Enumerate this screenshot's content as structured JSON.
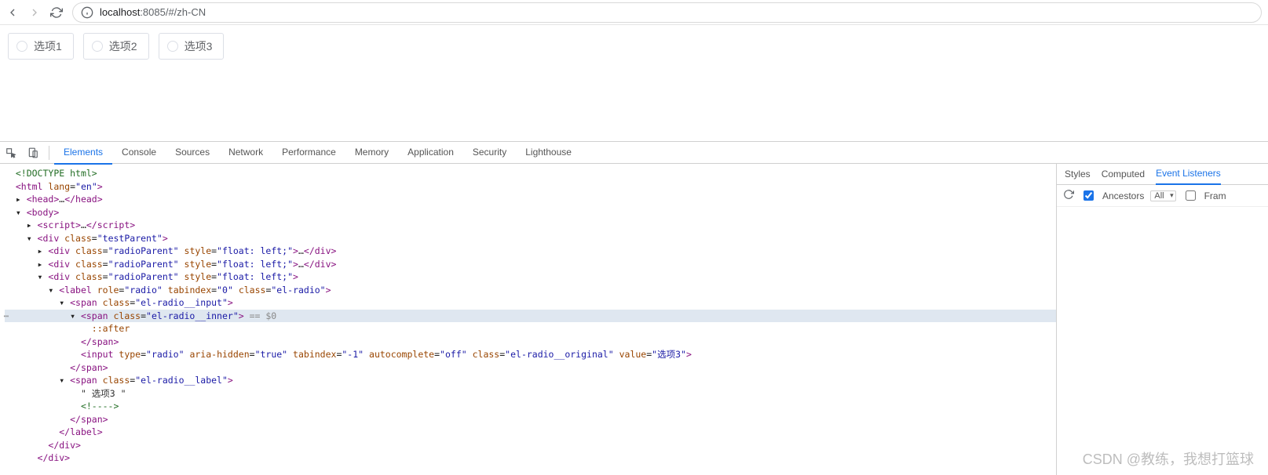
{
  "browser": {
    "url_prefix": "localhost",
    "url_rest": ":8085/#/zh-CN"
  },
  "page": {
    "radios": [
      "选项1",
      "选项2",
      "选项3"
    ]
  },
  "devtools": {
    "tabs": [
      "Elements",
      "Console",
      "Sources",
      "Network",
      "Performance",
      "Memory",
      "Application",
      "Security",
      "Lighthouse"
    ],
    "active_tab": "Elements",
    "side_tabs": [
      "Styles",
      "Computed",
      "Event Listeners"
    ],
    "side_active": "Event Listeners",
    "side_filter": {
      "ancestors_label": "Ancestors",
      "dropdown": "All",
      "framework_label": "Fram"
    }
  },
  "dom": {
    "l0": "<!DOCTYPE html>",
    "l1": {
      "open": "<html ",
      "a1n": "lang",
      "a1v": "\"en\"",
      "close": ">"
    },
    "l2": {
      "open": "<head>",
      "ell": "…",
      "close": "</head>"
    },
    "l3": "<body>",
    "l4": {
      "open": "<script>",
      "ell": "…",
      "close": "</script>"
    },
    "l5": {
      "open": "<div ",
      "a1n": "class",
      "a1v": "\"testParent\"",
      "close": ">"
    },
    "l6": {
      "open": "<div ",
      "a1n": "class",
      "a1v": "\"radioParent\"",
      "a2n": "style",
      "a2v": "\"float: left;\"",
      "mid": ">",
      "ell": "…",
      "close": "</div>"
    },
    "l7": {
      "open": "<div ",
      "a1n": "class",
      "a1v": "\"radioParent\"",
      "a2n": "style",
      "a2v": "\"float: left;\"",
      "mid": ">",
      "ell": "…",
      "close": "</div>"
    },
    "l8": {
      "open": "<div ",
      "a1n": "class",
      "a1v": "\"radioParent\"",
      "a2n": "style",
      "a2v": "\"float: left;\"",
      "close": ">"
    },
    "l9": {
      "open": "<label ",
      "a1n": "role",
      "a1v": "\"radio\"",
      "a2n": "tabindex",
      "a2v": "\"0\"",
      "a3n": "class",
      "a3v": "\"el-radio\"",
      "close": ">"
    },
    "l10": {
      "open": "<span ",
      "a1n": "class",
      "a1v": "\"el-radio__input\"",
      "close": ">"
    },
    "l11": {
      "open": "<span ",
      "a1n": "class",
      "a1v": "\"el-radio__inner\"",
      "close": ">",
      "marker": " == $0"
    },
    "l12": "::after",
    "l13": "</span>",
    "l14": {
      "open": "<input ",
      "a1n": "type",
      "a1v": "\"radio\"",
      "a2n": "aria-hidden",
      "a2v": "\"true\"",
      "a3n": "tabindex",
      "a3v": "\"-1\"",
      "a4n": "autocomplete",
      "a4v": "\"off\"",
      "a5n": "class",
      "a5v": "\"el-radio__original\"",
      "a6n": "value",
      "a6v": "\"选项3\"",
      "close": ">"
    },
    "l15": "</span>",
    "l16": {
      "open": "<span ",
      "a1n": "class",
      "a1v": "\"el-radio__label\"",
      "close": ">"
    },
    "l17": "\" 选项3 \"",
    "l18": "<!---->",
    "l19": "</span>",
    "l20": "</label>",
    "l21": "</div>",
    "l22": "</div>"
  },
  "watermark": "CSDN @教练，我想打篮球"
}
